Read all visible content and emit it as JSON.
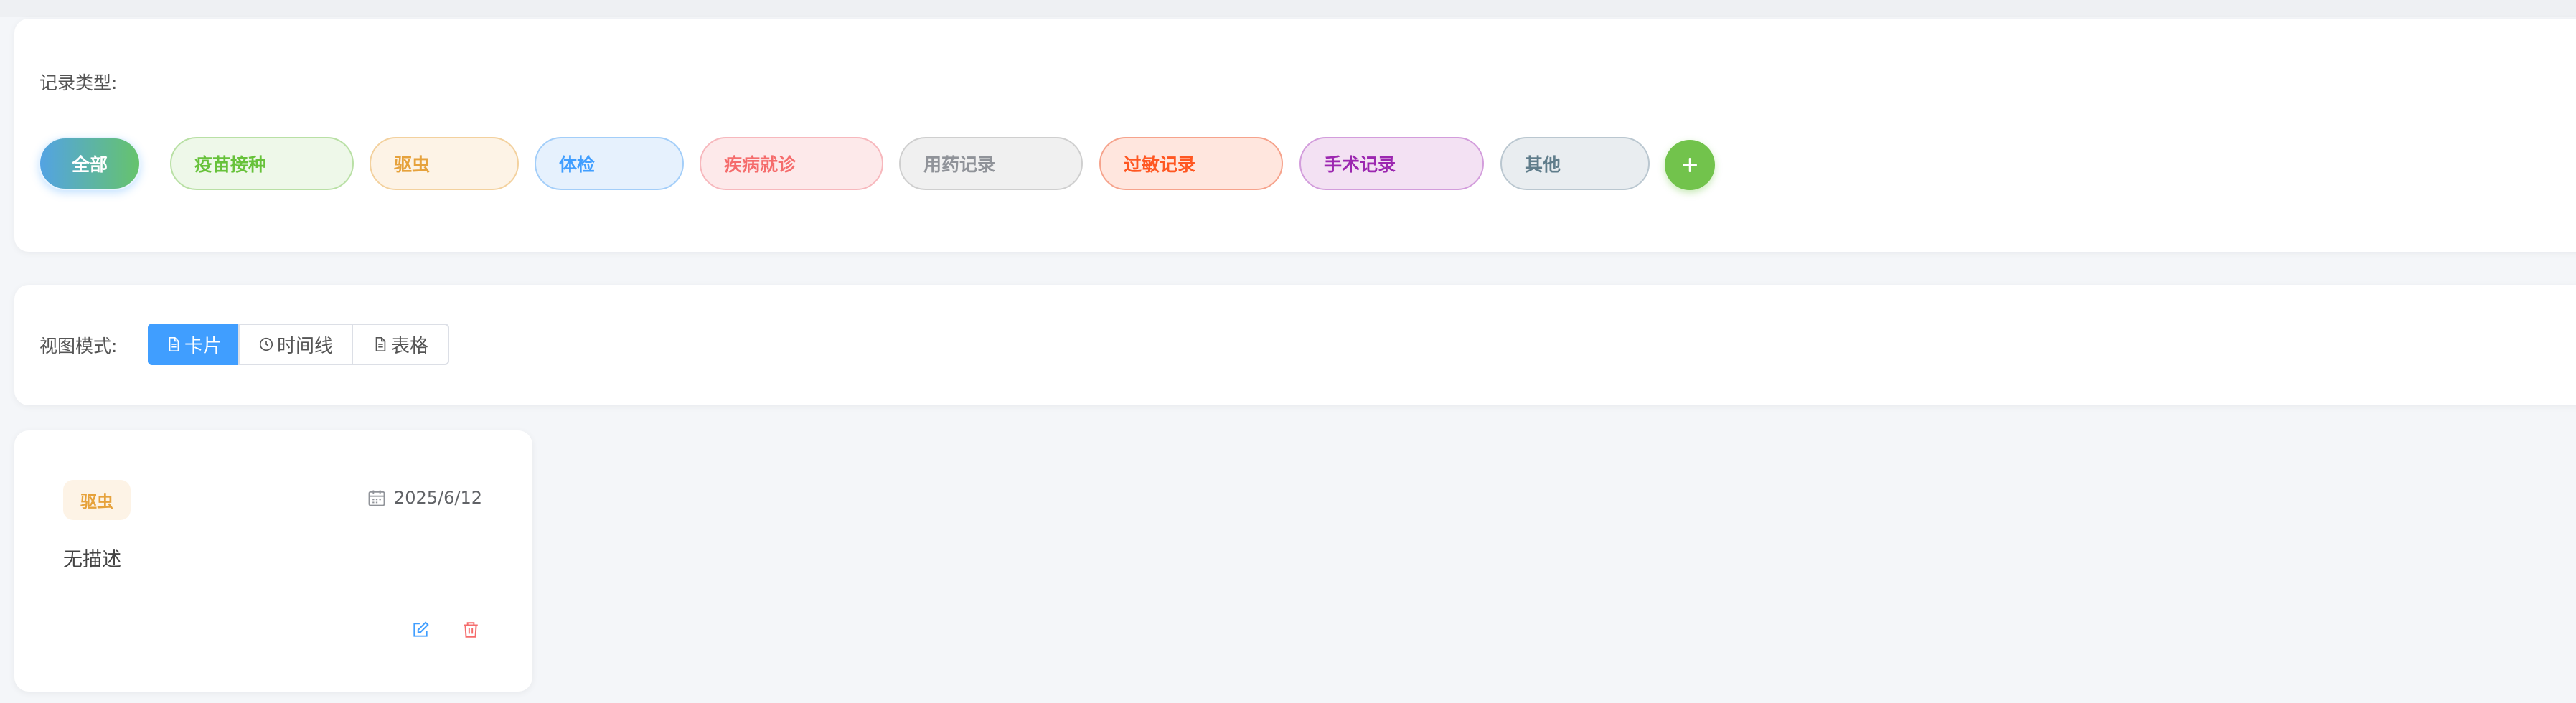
{
  "filter": {
    "label": "记录类型:",
    "chips": [
      {
        "label": "全部",
        "active": true
      },
      {
        "label": "疫苗接种",
        "color": "#67c23a",
        "bg": "#eef8e9",
        "border": "#b9e0a5"
      },
      {
        "label": "驱虫",
        "color": "#e6a23c",
        "bg": "#fdf3e6",
        "border": "#f3d19e"
      },
      {
        "label": "体检",
        "color": "#409eff",
        "bg": "#e6f1fd",
        "border": "#a3cef9"
      },
      {
        "label": "疾病就诊",
        "color": "#f56c6c",
        "bg": "#fde9ea",
        "border": "#f7b8bd"
      },
      {
        "label": "用药记录",
        "color": "#909399",
        "bg": "#f0f0f0",
        "border": "#cfcfcf"
      },
      {
        "label": "过敏记录",
        "color": "#ff5722",
        "bg": "#ffe6de",
        "border": "#f6a38c"
      },
      {
        "label": "手术记录",
        "color": "#9c27b0",
        "bg": "#f3e1f3",
        "border": "#d39ddc"
      },
      {
        "label": "其他",
        "color": "#607d8b",
        "bg": "#e9edf0",
        "border": "#bac7d0"
      }
    ],
    "add_icon": "plus-icon"
  },
  "view": {
    "label": "视图模式:",
    "modes": [
      {
        "label": "卡片",
        "icon": "document-icon",
        "active": true
      },
      {
        "label": "时间线",
        "icon": "clock-icon",
        "active": false
      },
      {
        "label": "表格",
        "icon": "document-icon",
        "active": false
      }
    ]
  },
  "records": [
    {
      "type": "驱虫",
      "date": "2025/6/12",
      "description": "无描述",
      "actions": {
        "edit_icon": "edit-icon",
        "delete_icon": "trash-icon"
      }
    }
  ],
  "colors": {
    "primary": "#409eff",
    "success": "#67c23a",
    "danger": "#f56c6c",
    "warning": "#e6a23c"
  }
}
